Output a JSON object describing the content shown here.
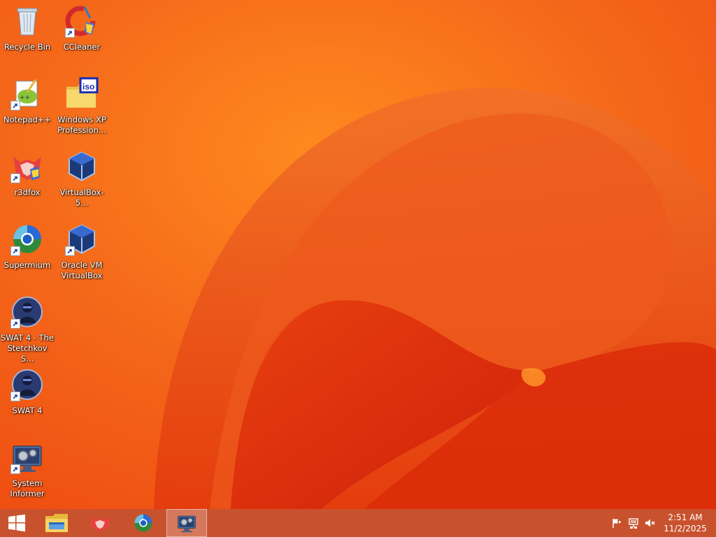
{
  "desktop": {
    "icons": [
      {
        "label": "Recycle Bin",
        "icon": "recycle-bin-icon",
        "shortcut": false
      },
      {
        "label": "CCleaner",
        "icon": "ccleaner-icon",
        "shortcut": true
      },
      {
        "label": "Notepad++",
        "icon": "notepad-plus-plus-icon",
        "shortcut": true
      },
      {
        "label": "Windows XP Profession...",
        "icon": "iso-file-icon",
        "shortcut": false
      },
      {
        "label": "r3dfox",
        "icon": "r3dfox-icon",
        "shortcut": true
      },
      {
        "label": "VirtualBox-5...",
        "icon": "virtualbox-installer-icon",
        "shortcut": false
      },
      {
        "label": "Supermium",
        "icon": "supermium-icon",
        "shortcut": true
      },
      {
        "label": "Oracle VM VirtualBox",
        "icon": "virtualbox-icon",
        "shortcut": true
      },
      {
        "label": "SWAT 4 - The Stetchkov S...",
        "icon": "swat4-expansion-icon",
        "shortcut": true
      },
      {
        "label": "SWAT 4",
        "icon": "swat4-icon",
        "shortcut": true
      },
      {
        "label": "System Informer",
        "icon": "system-informer-icon",
        "shortcut": true
      }
    ]
  },
  "taskbar": {
    "start_icon": "windows-logo-icon",
    "pinned": [
      {
        "icon": "file-explorer-icon",
        "active": false
      },
      {
        "icon": "r3dfox-icon",
        "active": false
      },
      {
        "icon": "supermium-icon",
        "active": false
      },
      {
        "icon": "system-informer-icon",
        "active": true
      }
    ],
    "tray": [
      "action-center-flag-icon",
      "network-icon",
      "volume-muted-icon"
    ],
    "clock": {
      "time": "2:51 AM",
      "date": "11/2/2025"
    }
  },
  "colors": {
    "wallpaper_base": "#f25a10",
    "wallpaper_dark": "#d8260a",
    "taskbar": "#c9522e"
  }
}
